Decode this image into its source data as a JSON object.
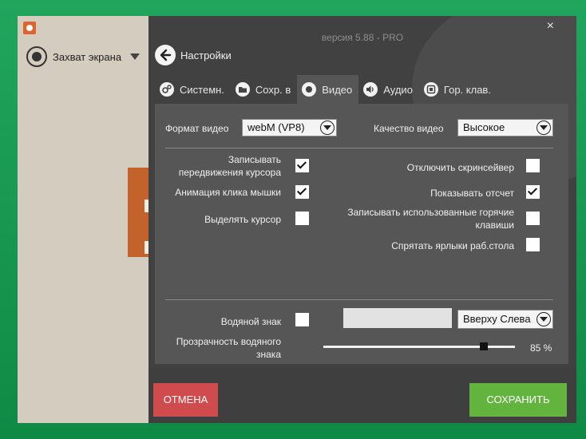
{
  "app": {
    "version": "версия 5.88 - PRO",
    "capture_label": "Захват экрана",
    "close_glyph": "×"
  },
  "header": {
    "back_label": "Настройки"
  },
  "tabs": [
    {
      "label": "Системн.",
      "icon": "gear-icon",
      "active": false
    },
    {
      "label": "Сохр. в",
      "icon": "folder-icon",
      "active": false
    },
    {
      "label": "Видео",
      "icon": "record-icon",
      "active": true
    },
    {
      "label": "Аудио",
      "icon": "speaker-icon",
      "active": false
    },
    {
      "label": "Гор. клав.",
      "icon": "hotkey-icon",
      "active": false
    }
  ],
  "video": {
    "format_label": "Формат видео",
    "format_value": "webM (VP8)",
    "quality_label": "Качество видео",
    "quality_value": "Высокое"
  },
  "options": {
    "record_cursor": {
      "label": "Записывать передвижения курсора",
      "checked": true
    },
    "click_animation": {
      "label": "Анимация клика мышки",
      "checked": true
    },
    "highlight_cursor": {
      "label": "Выделять курсор",
      "checked": false
    },
    "disable_screensaver": {
      "label": "Отключить скринсейвер",
      "checked": false
    },
    "show_countdown": {
      "label": "Показывать отсчет",
      "checked": true
    },
    "record_hotkeys": {
      "label": "Записывать использованные горячие клавиши",
      "checked": false
    },
    "hide_desktop_icons": {
      "label": "Спрятать ярлыки раб.стола",
      "checked": false
    }
  },
  "watermark": {
    "label": "Водяной знак",
    "checked": false,
    "position_value": "Вверху Слева",
    "opacity_label": "Прозрачность водяного знака",
    "opacity_value": 0.85,
    "opacity_text": "85 %"
  },
  "footer": {
    "cancel_label": "ОТМЕНА",
    "save_label": "СОХРАНИТЬ"
  },
  "colors": {
    "cancel": "#d04b4d",
    "save": "#63b43f",
    "panel": "#565656",
    "desktop": "#1a9a52"
  }
}
